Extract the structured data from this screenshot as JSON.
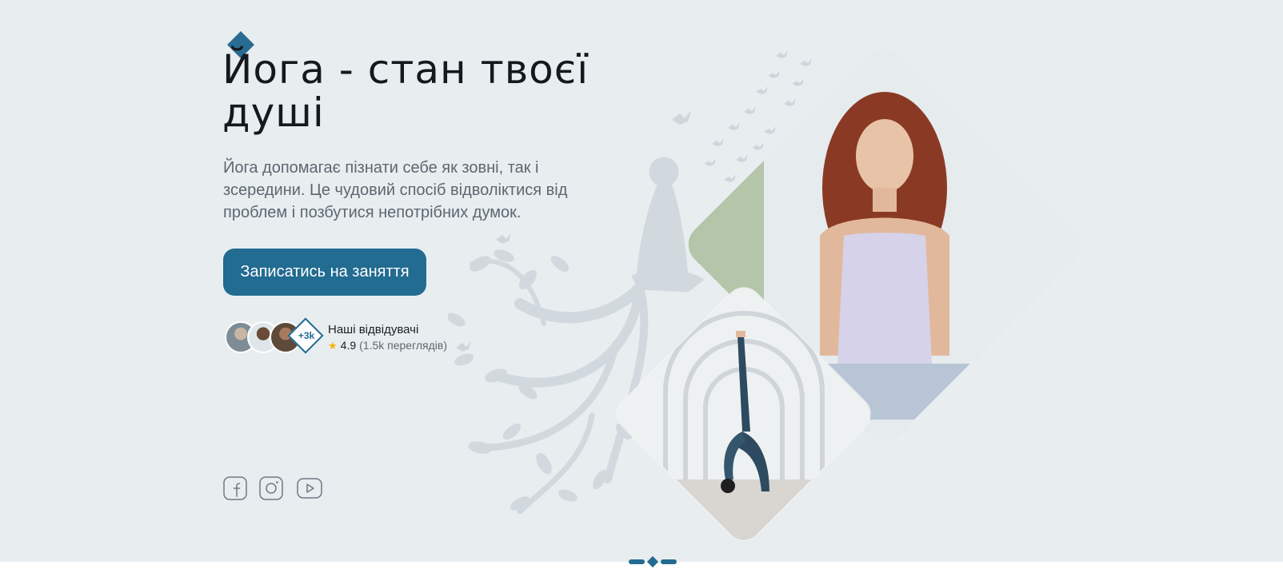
{
  "hero": {
    "title": "Йога - стан твоєї душі",
    "description": "Йога допомагає пізнати себе як зовні, так і зсередини. Це чудовий спосіб відволіктися від проблем і позбутися непотрібних думок.",
    "cta_label": "Записатись на заняття"
  },
  "visitors": {
    "badge": "+3k",
    "label": "Наші відвідувачі",
    "rating": "4.9",
    "views": "(1.5k переглядів)",
    "star_icon": "star-icon"
  },
  "social": {
    "icons": [
      "facebook-icon",
      "instagram-icon",
      "youtube-icon"
    ]
  },
  "pager": {
    "active_index": 1,
    "count": 3
  },
  "colors": {
    "background": "#e8edf0",
    "accent": "#226b91",
    "text": "#15191d",
    "muted_text": "#5d6770"
  }
}
